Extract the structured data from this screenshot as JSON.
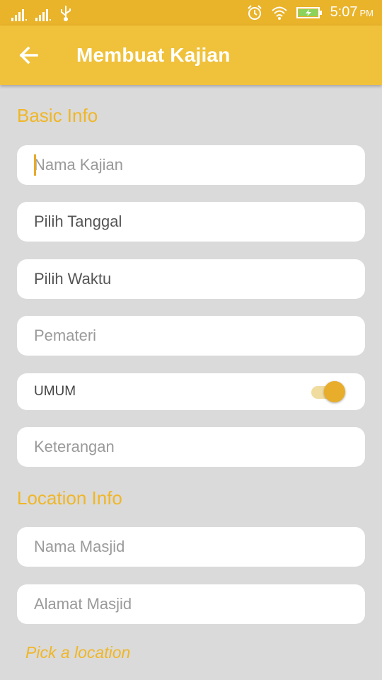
{
  "status_bar": {
    "time": "5:07",
    "ampm": "PM",
    "icons": [
      "signal-icon",
      "signal-icon",
      "usb-icon",
      "alarm-icon",
      "wifi-icon",
      "battery-charging-icon"
    ]
  },
  "app_bar": {
    "title": "Membuat Kajian",
    "back_icon": "arrow-left-icon"
  },
  "sections": {
    "basic_info": "Basic Info",
    "location_info": "Location Info"
  },
  "fields": {
    "nama_kajian": {
      "placeholder": "Nama Kajian",
      "value": ""
    },
    "tanggal": {
      "value": "Pilih Tanggal"
    },
    "waktu": {
      "value": "Pilih Waktu"
    },
    "pemateri": {
      "placeholder": "Pemateri",
      "value": ""
    },
    "umum": {
      "label": "UMUM",
      "on": true
    },
    "keterangan": {
      "placeholder": "Keterangan",
      "value": ""
    },
    "nama_masjid": {
      "placeholder": "Nama Masjid",
      "value": ""
    },
    "alamat_masjid": {
      "placeholder": "Alamat Masjid",
      "value": ""
    }
  },
  "pick_location": "Pick a location",
  "colors": {
    "status_bar": "#e9b32a",
    "app_bar": "#f0c13a",
    "accent": "#f0b626",
    "background": "#dadada"
  }
}
